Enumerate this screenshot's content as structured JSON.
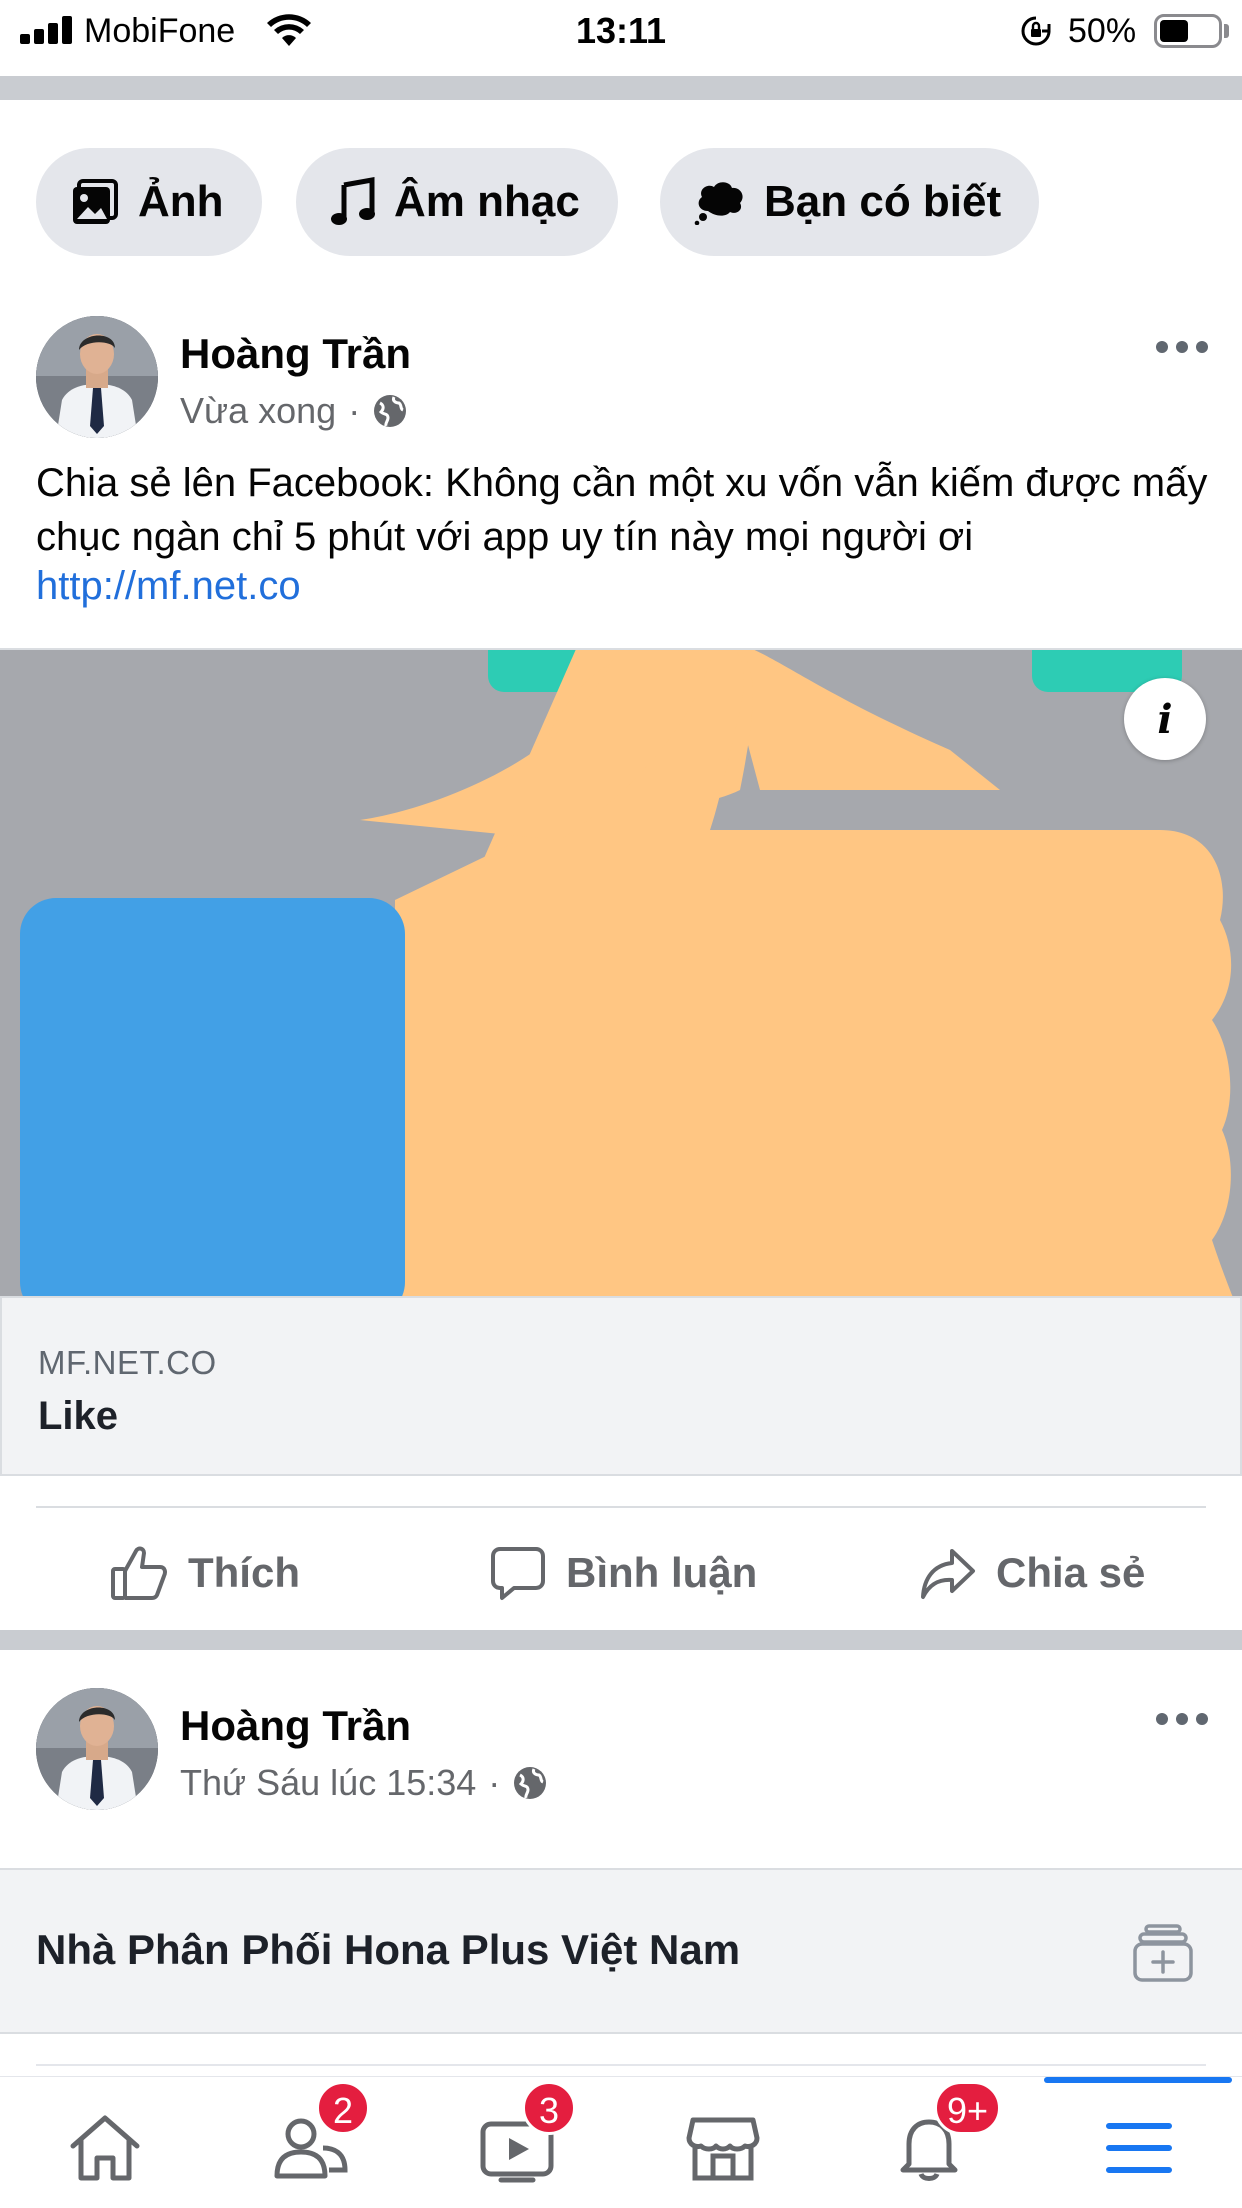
{
  "status_bar": {
    "carrier": "MobiFone",
    "time": "13:11",
    "battery_percent": "50%",
    "battery_level": 0.5
  },
  "chips": [
    {
      "label": "Ảnh",
      "icon": "photo-icon"
    },
    {
      "label": "Âm nhạc",
      "icon": "music-note-icon"
    },
    {
      "label": "Bạn có biết",
      "icon": "thought-bubble-icon"
    }
  ],
  "post1": {
    "author": "Hoàng Trần",
    "time": "Vừa xong",
    "separator": "·",
    "privacy_icon": "globe-icon",
    "text": "Chia sẻ lên Facebook: Không cần một xu vốn vẫn kiếm được mấy chục ngàn chỉ 5 phút với app uy tín này mọi người ơi",
    "link": "http://mf.net.co",
    "info_label": "i",
    "link_card": {
      "domain": "MF.NET.CO",
      "title": "Like"
    },
    "colors": {
      "media_bg": "#a6a8ad",
      "thumb": "#ffc683",
      "cuff": "#42a0e6",
      "teal": "#2dccb4"
    }
  },
  "actions": [
    {
      "label": "Thích",
      "icon": "thumbs-up-icon"
    },
    {
      "label": "Bình luận",
      "icon": "comment-icon"
    },
    {
      "label": "Chia sẻ",
      "icon": "share-icon"
    }
  ],
  "post2": {
    "author": "Hoàng Trần",
    "time": "Thứ Sáu lúc 15:34",
    "separator": "·",
    "privacy_icon": "globe-icon",
    "card_title": "Nhà Phân Phối Hona Plus Việt Nam",
    "card_icon": "add-collection-icon"
  },
  "bottom_nav": [
    {
      "name": "home",
      "icon": "home-icon",
      "badge": ""
    },
    {
      "name": "friends",
      "icon": "friends-icon",
      "badge": "2"
    },
    {
      "name": "watch",
      "icon": "watch-icon",
      "badge": "3"
    },
    {
      "name": "marketplace",
      "icon": "marketplace-icon",
      "badge": ""
    },
    {
      "name": "notifications",
      "icon": "bell-icon",
      "badge": "9+"
    },
    {
      "name": "menu",
      "icon": "menu-icon",
      "badge": ""
    }
  ],
  "accent_color": "#1877f2",
  "badge_color": "#e41e3f"
}
